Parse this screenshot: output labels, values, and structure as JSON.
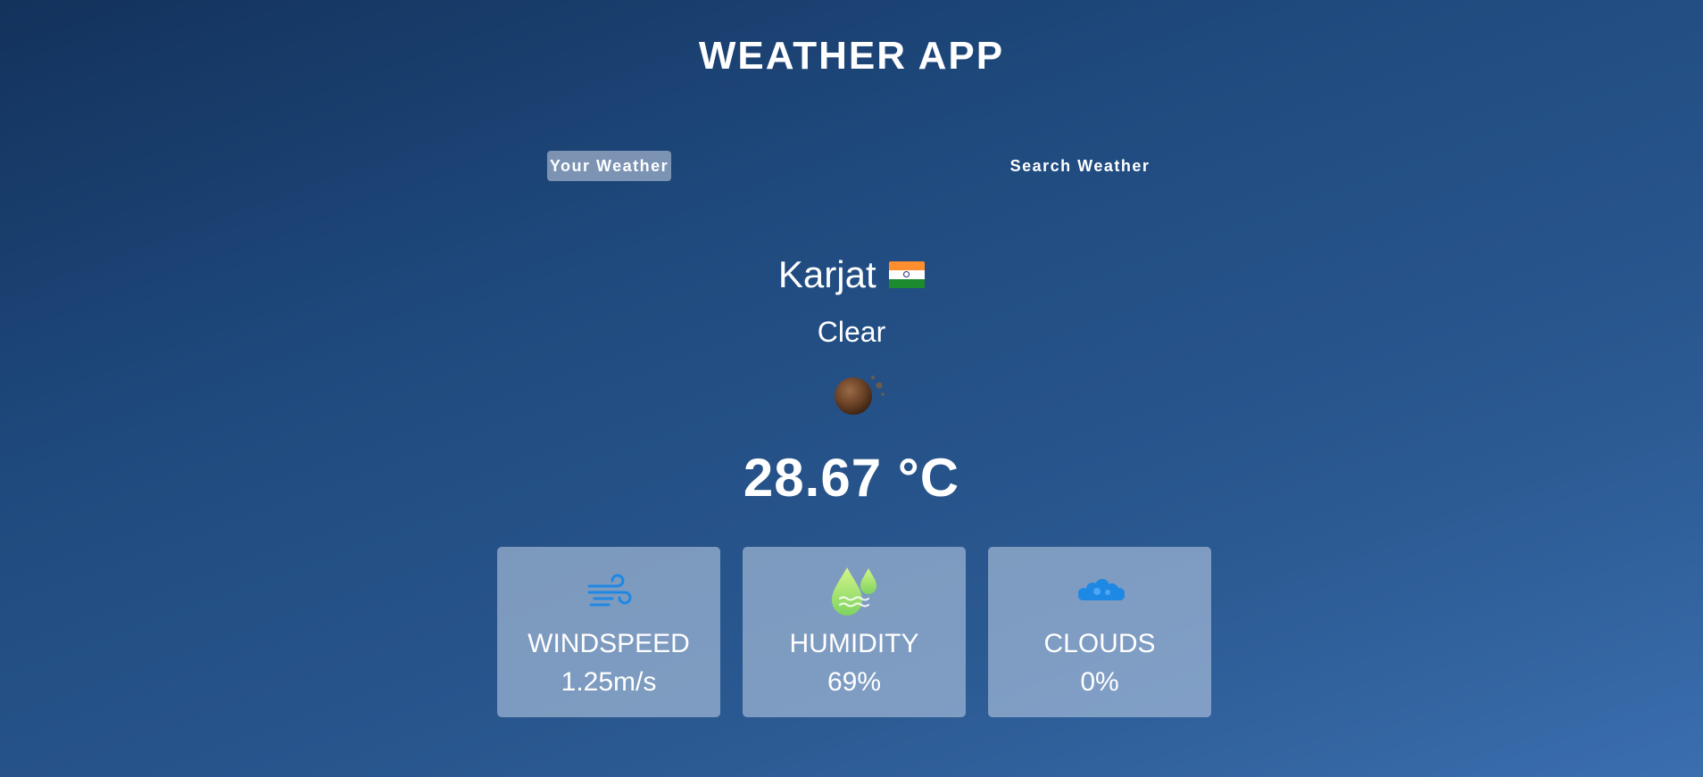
{
  "app": {
    "title": "WEATHER APP"
  },
  "tabs": [
    {
      "label": "Your Weather",
      "active": true
    },
    {
      "label": "Search Weather",
      "active": false
    }
  ],
  "location": {
    "city": "Karjat",
    "flag_icon": "india-flag-icon"
  },
  "weather": {
    "condition": "Clear",
    "icon": "clear-night-moon-icon",
    "temperature": "28.67 °C"
  },
  "stats": [
    {
      "label": "WINDSPEED",
      "value": "1.25m/s",
      "icon": "wind-icon"
    },
    {
      "label": "HUMIDITY",
      "value": "69%",
      "icon": "humidity-drops-icon"
    },
    {
      "label": "CLOUDS",
      "value": "0%",
      "icon": "clouds-icon"
    }
  ],
  "colors": {
    "background_top": "#13325c",
    "background_bottom": "#3a6eae",
    "card_background": "#bccde5",
    "wind_icon": "#1e88e5",
    "humidity_icon_top": "#c6f27a",
    "humidity_icon_bottom": "#7ed35f",
    "clouds_icon": "#1e88e5"
  }
}
